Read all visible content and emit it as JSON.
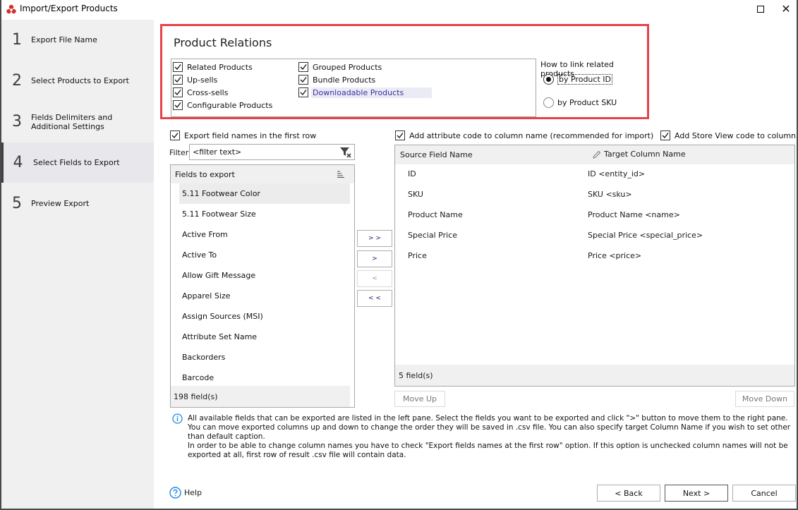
{
  "window": {
    "title": "Import/Export Products",
    "icon": "app-logo-icon",
    "maximize_icon": "maximize-icon",
    "close_icon": "close-icon",
    "close_glyph": "✕"
  },
  "sidebar": {
    "steps": [
      {
        "num": "1",
        "label": "Export File Name",
        "active": false
      },
      {
        "num": "2",
        "label": "Select Products to Export",
        "active": false
      },
      {
        "num": "3",
        "label": "Fields Delimiters and Additional Settings",
        "active": false
      },
      {
        "num": "4",
        "label": "Select Fields to Export",
        "active": true
      },
      {
        "num": "5",
        "label": "Preview Export",
        "active": false
      }
    ]
  },
  "relations": {
    "title": "Product Relations",
    "highlight_color": "#e8414a",
    "col1": [
      {
        "label": "Related Products",
        "checked": true
      },
      {
        "label": "Up-sells",
        "checked": true
      },
      {
        "label": "Cross-sells",
        "checked": true
      },
      {
        "label": "Configurable Products",
        "checked": true
      }
    ],
    "col2": [
      {
        "label": "Grouped Products",
        "checked": true
      },
      {
        "label": "Bundle Products",
        "checked": true
      },
      {
        "label": "Downloadable Products",
        "checked": true,
        "focused": true
      }
    ],
    "link_title": "How to link related products",
    "link_options": [
      {
        "label": "by Product ID",
        "selected": true
      },
      {
        "label": "by Product SKU",
        "selected": false
      }
    ]
  },
  "options": {
    "export_names_label": "Export field names in the  first row",
    "export_names_checked": true,
    "add_attr_code_label": "Add attribute code to column name (recommended for import)",
    "add_attr_code_checked": true,
    "add_store_view_label": "Add Store View code to column nam",
    "add_store_view_checked": true
  },
  "filter": {
    "label": "Filter",
    "value": "<filter text>"
  },
  "left_list": {
    "header": "Fields to export",
    "items": [
      "5.11 Footwear Color",
      "5.11 Footwear Size",
      "Active From",
      "Active To",
      "Allow Gift Message",
      "Apparel Size",
      "Assign Sources (MSI)",
      "Attribute Set Name",
      "Backorders",
      "Barcode"
    ],
    "selected_index": 0,
    "footer": "198 field(s)"
  },
  "move_buttons": {
    "add_all": "> >",
    "add": ">",
    "remove": "<",
    "remove_all": "< <"
  },
  "right_table": {
    "col_source": "Source Field Name",
    "col_target": "Target Column Name",
    "rows": [
      {
        "source": "ID",
        "target": "ID <entity_id>"
      },
      {
        "source": "SKU",
        "target": "SKU <sku>"
      },
      {
        "source": "Product Name",
        "target": "Product Name <name>"
      },
      {
        "source": "Special Price",
        "target": "Special Price <special_price>"
      },
      {
        "source": "Price",
        "target": "Price <price>"
      }
    ],
    "footer": "5 field(s)"
  },
  "order_buttons": {
    "move_up": "Move Up",
    "move_down": "Move Down"
  },
  "info": {
    "line1": "All available fields that can be exported are listed in the left pane. Select the fields you want to be exported and click \">\" button to move them to the right pane. You can move exported columns up and down to change the order they will be saved in .csv file. You can also specify target Column Name if you wish to set other than default caption.",
    "line2": "In order to be able to change column names you have to check \"Export fields names at the first row\" option. If this option is unchecked column names will not be exported at all, first row of result .csv file will contain data."
  },
  "footer": {
    "help": "Help",
    "back": "< Back",
    "next": "Next >",
    "cancel": "Cancel"
  }
}
